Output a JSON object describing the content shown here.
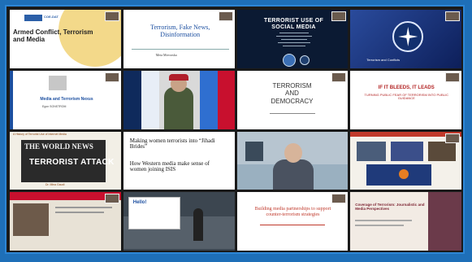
{
  "tiles": {
    "t1": {
      "title": "Armed Conflict, Terrorism and Media",
      "logo": "COE-DAT"
    },
    "t2": {
      "title": "Terrorism, Fake News, Disinformation",
      "author": "Meta Mirvorska"
    },
    "t3": {
      "title": "TERRORIST USE OF SOCIAL MEDIA"
    },
    "t4": {
      "caption": "Terrorism and Conflicts"
    },
    "t5": {
      "title": "Media and Terrorism Nexus",
      "author": "Egon SONSTROM"
    },
    "t6": {
      "caption": ""
    },
    "t7": {
      "title_lines": [
        "TERRORISM",
        "AND",
        "DEMOCRACY"
      ]
    },
    "t8": {
      "title": "IF IT BLEEDS, IT LEADS",
      "subtitle": "TURNING PUBLIC FEAR OF TERRORISM INTO PUBLIC GUIDANCE"
    },
    "t9": {
      "header": "A History of Terrorist Use of Internet Media",
      "headline_1": "THE WORLD NEWS",
      "headline_2": "TERRORIST ATTACK",
      "footer": "Dr. Mina Gaudi"
    },
    "t10": {
      "text_1": "Making women terrorists into “Jihadi Brides”",
      "text_2": "How Western media make sense of women joining ISIS"
    },
    "t11": {
      "caption": ""
    },
    "t12": {
      "caption": ""
    },
    "t13": {
      "caption": ""
    },
    "t14": {
      "greeting": "Hello!"
    },
    "t15": {
      "title": "Building media partnerships to support counter-terrorism strategies"
    },
    "t16": {
      "title": "Coverage of Terrorism: Journalistic and Media Perspectives"
    }
  },
  "colors": {
    "accent": "#1e6fb8",
    "nato_blue": "#0f2a5c",
    "flag_red": "#c8102e"
  }
}
